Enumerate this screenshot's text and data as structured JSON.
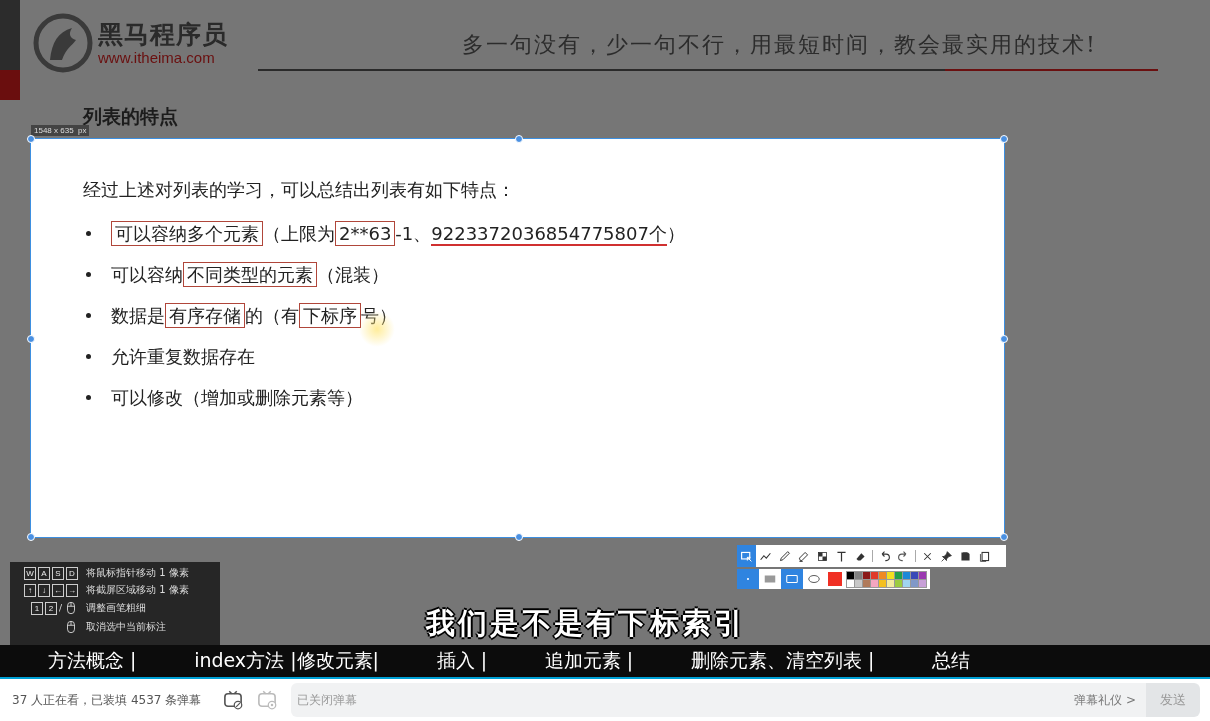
{
  "slide": {
    "brand": "黑马程序员",
    "brand_url": "www.itheima.com",
    "slogan": "多一句没有，少一句不行，用最短时间，教会最实用的技术!",
    "title": "列表的特点"
  },
  "capture": {
    "size_label": "1548 x 635  px",
    "intro": "经过上述对列表的学习，可以总结出列表有如下特点：",
    "bullets": [
      {
        "segments": [
          {
            "kind": "box",
            "text": "可以容纳多个元素"
          },
          {
            "kind": "text",
            "text": "（上限为"
          },
          {
            "kind": "box",
            "text": "2**63"
          },
          {
            "kind": "text",
            "text": "-1、"
          },
          {
            "kind": "underline",
            "text": "9223372036854775807个"
          },
          {
            "kind": "text",
            "text": "）"
          }
        ]
      },
      {
        "segments": [
          {
            "kind": "text",
            "text": "可以容纳"
          },
          {
            "kind": "box",
            "text": "不同类型的元素"
          },
          {
            "kind": "text",
            "text": "（混装）"
          }
        ]
      },
      {
        "segments": [
          {
            "kind": "text",
            "text": "数据是"
          },
          {
            "kind": "box",
            "text": "有序存储"
          },
          {
            "kind": "text",
            "text": "的（有"
          },
          {
            "kind": "box",
            "text": "下标序"
          },
          {
            "kind": "text",
            "text": "号）"
          }
        ]
      },
      {
        "segments": [
          {
            "kind": "text",
            "text": "允许重复数据存在"
          }
        ]
      },
      {
        "segments": [
          {
            "kind": "text",
            "text": "可以修改（增加或删除元素等）"
          }
        ]
      }
    ]
  },
  "toolbar": {
    "tool_groups": [
      [
        {
          "kind": "region",
          "selected": true
        },
        {
          "kind": "polyline",
          "selected": false
        },
        {
          "kind": "pen",
          "selected": false
        },
        {
          "kind": "marker",
          "selected": false
        },
        {
          "kind": "mosaic",
          "selected": false
        },
        {
          "kind": "text",
          "selected": false
        },
        {
          "kind": "eraser",
          "selected": false
        }
      ],
      [
        {
          "kind": "undo",
          "selected": false
        },
        {
          "kind": "redo",
          "selected": false
        }
      ],
      [
        {
          "kind": "close",
          "selected": false
        },
        {
          "kind": "pin",
          "selected": false
        },
        {
          "kind": "save",
          "selected": false
        },
        {
          "kind": "copy",
          "selected": false
        }
      ]
    ],
    "options": [
      {
        "kind": "dot",
        "selected": true
      },
      {
        "kind": "filled-rect",
        "selected": false
      },
      {
        "kind": "outline-rect",
        "selected": true
      },
      {
        "kind": "ellipse",
        "selected": false
      }
    ],
    "palette": [
      {
        "color": "#000000"
      },
      {
        "color": "#808080"
      },
      {
        "color": "#8b1a1a"
      },
      {
        "color": "#e03a2a"
      },
      {
        "color": "#f08a24"
      },
      {
        "color": "#f2e020"
      },
      {
        "color": "#22a04a"
      },
      {
        "color": "#1e88d8"
      },
      {
        "color": "#3a4ab8"
      },
      {
        "color": "#9b3ab0"
      },
      {
        "color": "#ffffff"
      },
      {
        "color": "#c8c8c8"
      },
      {
        "color": "#b07a5a"
      },
      {
        "color": "#f4a6c0"
      },
      {
        "color": "#f4c020"
      },
      {
        "color": "#f4eca0"
      },
      {
        "color": "#9ccc40"
      },
      {
        "color": "#a0d4f0"
      },
      {
        "color": "#8098c8"
      },
      {
        "color": "#c8a0d8"
      }
    ]
  },
  "help": [
    {
      "keys": [
        {
          "kind": "key",
          "label": "W"
        },
        {
          "kind": "key",
          "label": "A"
        },
        {
          "kind": "key",
          "label": "S"
        },
        {
          "kind": "key",
          "label": "D"
        }
      ],
      "description": "将鼠标指针移动 1 像素"
    },
    {
      "keys": [
        {
          "kind": "key",
          "label": "↑"
        },
        {
          "kind": "key",
          "label": "↓"
        },
        {
          "kind": "key",
          "label": "←"
        },
        {
          "kind": "key",
          "label": "→"
        }
      ],
      "description": "将截屏区域移动 1 像素"
    },
    {
      "keys": [
        {
          "kind": "key",
          "label": "1"
        },
        {
          "kind": "key",
          "label": "2"
        },
        {
          "kind": "sep",
          "label": "/"
        },
        {
          "kind": "mouse"
        }
      ],
      "description": "调整画笔粗细"
    },
    {
      "keys": [
        {
          "kind": "mouse"
        }
      ],
      "description": "取消选中当前标注"
    }
  ],
  "subtitle": "我们是不是有下标索引",
  "progress_bar": {
    "level": 1
  },
  "chapters": [
    "方法概念 |",
    "index方法 |修改元素|",
    "插入 |",
    "追加元素 |",
    "删除元素、清空列表 |",
    "总结"
  ],
  "bottom_bar": {
    "viewers": "37 人正在看，已装填 4537 条弹幕",
    "danmaku_input": {
      "placeholder": "已关闭弹幕"
    },
    "etiquette_link": "弹幕礼仪 >",
    "send_button": {
      "label": "发送",
      "disabled": true
    }
  }
}
